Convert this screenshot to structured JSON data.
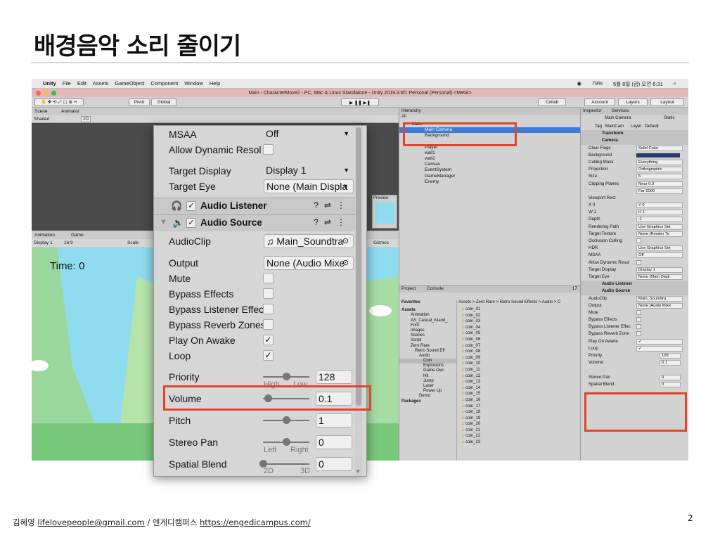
{
  "slide": {
    "title": "배경음악 소리 줄이기",
    "page_number": "2",
    "footer": {
      "author": "김혜영",
      "email": "lifelovepeople@gmail.com",
      "separator": "/",
      "org": "엔게디캠퍼스",
      "url": "https://engedicampus.com/"
    }
  },
  "macos": {
    "menu": [
      "Unity",
      "File",
      "Edit",
      "Assets",
      "GameObject",
      "Component",
      "Window",
      "Help"
    ],
    "battery": "79%",
    "clock": "5월 8일 (금) 오전 6:31"
  },
  "unity": {
    "window_title": "Main - CharacterMove2 - PC, Mac & Linux Standalone - Unity 2019.3.6f1 Personal (Personal) <Metal>",
    "toolbar": {
      "pivot": "Pivot",
      "global": "Global",
      "collab": "Collab",
      "account": "Account",
      "layers": "Layers",
      "layout": "Layout"
    },
    "scene_tabs": {
      "scene": "Scene",
      "animator": "Animator",
      "shaded": "Shaded",
      "mode2d": "2D"
    },
    "game_tabs": {
      "animation": "Animation",
      "game": "Game",
      "display": "Display 1",
      "aspect": "16:9",
      "scale": "Scale",
      "gizmos": "Gizmos",
      "preview": "Preview"
    },
    "game": {
      "time_label": "Time: 0"
    },
    "hierarchy": {
      "tab": "Hierarchy",
      "search": "All",
      "items": [
        "Main",
        "Main Camera",
        "Background",
        "Player",
        "wall1",
        "wall2",
        "Canvas",
        "EventSystem",
        "GameManager",
        "Enemy"
      ]
    },
    "project": {
      "tabs": [
        "Project",
        "Console"
      ],
      "tree": [
        "Favorites",
        "Assets",
        "Animation",
        "AS_Casual_Island_",
        "Font",
        "Images",
        "Scenes",
        "Script",
        "Zero Rare",
        "Retro Sound Eff",
        "Audio",
        "Coin",
        "Explosions",
        "Game Ove",
        "Hit",
        "Jump",
        "Laser",
        "Power Up",
        "Demo",
        "Packages"
      ],
      "breadcrumb": "Assets > Zero Rare > Retro Sound Effects > Audio > C",
      "files": [
        "coin_01",
        "coin_02",
        "coin_03",
        "coin_04",
        "coin_05",
        "coin_06",
        "coin_07",
        "coin_08",
        "coin_09",
        "coin_10",
        "coin_11",
        "coin_12",
        "coin_13",
        "coin_14",
        "coin_15",
        "coin_16",
        "coin_17",
        "coin_18",
        "coin_19",
        "coin_20",
        "coin_21",
        "coin_22",
        "coin_23"
      ],
      "count": "17"
    },
    "inspector": {
      "tabs": [
        "Inspector",
        "Services"
      ],
      "object_name": "Main Camera",
      "static_label": "Static",
      "tag_label": "Tag",
      "tag": "MainCam",
      "layer_label": "Layer",
      "layer": "Default",
      "transform": "Transform",
      "camera": "Camera",
      "rows": [
        {
          "label": "Clear Flags",
          "value": "Solid Color"
        },
        {
          "label": "Background",
          "value": ""
        },
        {
          "label": "Culling Mask",
          "value": "Everything"
        },
        {
          "label": "Projection",
          "value": "Orthographic"
        },
        {
          "label": "Size",
          "value": "5"
        },
        {
          "label": "Clipping Planes",
          "value": "Near  0.3"
        },
        {
          "label": "",
          "value": "Far   1000"
        },
        {
          "label": "Viewport Rect",
          "value": ""
        },
        {
          "label": "X 0",
          "value": "Y 0"
        },
        {
          "label": "W 1",
          "value": "H 1"
        },
        {
          "label": "Depth",
          "value": "-1"
        },
        {
          "label": "Rendering Path",
          "value": "Use Graphics Set"
        },
        {
          "label": "Target Texture",
          "value": "None (Render Te"
        },
        {
          "label": "Occlusion Culling",
          "value": ""
        },
        {
          "label": "HDR",
          "value": "Use Graphics Set"
        },
        {
          "label": "MSAA",
          "value": "Off"
        },
        {
          "label": "Allow Dynamic Resol",
          "value": ""
        },
        {
          "label": "Target Display",
          "value": "Display 1"
        },
        {
          "label": "Target Eye",
          "value": "None (Main Displ"
        }
      ],
      "audio_listener": "Audio Listener",
      "audio_source": "Audio Source",
      "audio_rows": [
        {
          "label": "AudioClip",
          "value": "Main_Soundtra"
        },
        {
          "label": "Output",
          "value": "None (Audio Mixe"
        },
        {
          "label": "Mute",
          "value": ""
        },
        {
          "label": "Bypass Effects",
          "value": ""
        },
        {
          "label": "Bypass Listener Effec",
          "value": ""
        },
        {
          "label": "Bypass Reverb Zone",
          "value": ""
        },
        {
          "label": "Play On Awake",
          "value": "✓"
        },
        {
          "label": "Loop",
          "value": "✓"
        }
      ],
      "priority": {
        "label": "Priority",
        "value": "128"
      },
      "volume": {
        "label": "Volume",
        "value": "0.1"
      },
      "stereo": {
        "label": "Stereo Pan",
        "value": "0"
      },
      "spatial": {
        "label": "Spatial Blend",
        "value": "0"
      }
    }
  },
  "zoom_panel": {
    "msaa": {
      "label": "MSAA",
      "value": "Off"
    },
    "allow_dynamic": {
      "label": "Allow Dynamic Resol"
    },
    "target_display": {
      "label": "Target Display",
      "value": "Display 1"
    },
    "target_eye": {
      "label": "Target Eye",
      "value": "None (Main Displa"
    },
    "audio_listener": "Audio Listener",
    "audio_source": "Audio Source",
    "audio_clip": {
      "label": "AudioClip",
      "value": "♫ Main_Soundtra"
    },
    "output": {
      "label": "Output",
      "value": "None (Audio Mixe"
    },
    "mute": {
      "label": "Mute"
    },
    "bypass_effects": {
      "label": "Bypass Effects"
    },
    "bypass_listener": {
      "label": "Bypass Listener Effec"
    },
    "bypass_reverb": {
      "label": "Bypass Reverb Zones"
    },
    "play_on_awake": {
      "label": "Play On Awake",
      "checked": "✓"
    },
    "loop": {
      "label": "Loop",
      "checked": "✓"
    },
    "priority": {
      "label": "Priority",
      "value": "128",
      "low_hint": "High",
      "high_hint": "Low",
      "level": 0.5
    },
    "volume": {
      "label": "Volume",
      "value": "0.1",
      "level": 0.1
    },
    "pitch": {
      "label": "Pitch",
      "value": "1",
      "level": 0.5
    },
    "stereo_pan": {
      "label": "Stereo Pan",
      "value": "0",
      "left": "Left",
      "right": "Right",
      "level": 0.5
    },
    "spatial_blend": {
      "label": "Spatial Blend",
      "value": "0",
      "left": "2D",
      "right": "3D",
      "level": 0.0
    }
  },
  "colors": {
    "highlight": "#e0452b",
    "selection": "#3d7bd9",
    "sky": "#8fdcf0"
  }
}
